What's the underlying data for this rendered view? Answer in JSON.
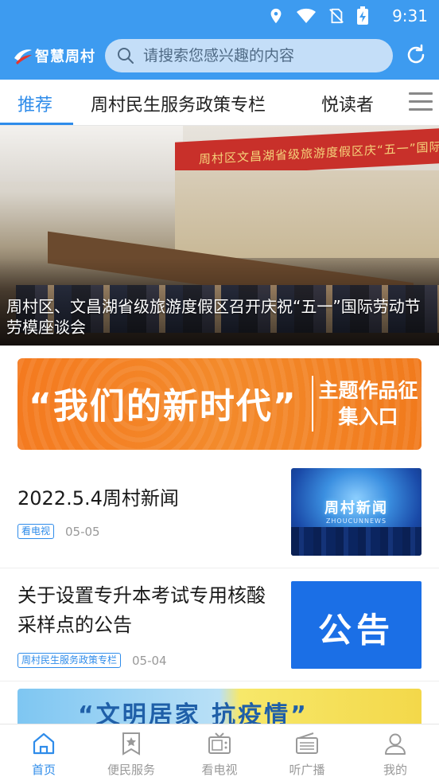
{
  "status_bar": {
    "time": "9:31",
    "icons": [
      "location-icon",
      "wifi-icon",
      "no-sim-icon",
      "battery-charging-icon"
    ]
  },
  "header": {
    "app_name": "智慧周村",
    "search_placeholder": "请搜索您感兴趣的内容",
    "refresh_icon": "refresh-icon",
    "brand_color": "#3d9bf0"
  },
  "tabs": {
    "items": [
      {
        "label": "推荐",
        "active": true
      },
      {
        "label": "周村民生服务政策专栏",
        "active": false
      },
      {
        "label": "悦读者",
        "active": false
      }
    ],
    "menu_icon": "menu-icon",
    "accent_color": "#2f8cea"
  },
  "hero": {
    "caption": "周村区、文昌湖省级旅游度假区召开庆祝“五一”国际劳动节劳模座谈会",
    "banner_text": "周村区文昌湖省级旅游度假区庆“五一”国际劳动节劳模座谈会"
  },
  "promo": {
    "main_text": "“我们的新时代”",
    "side_text": "主题作品征集入口",
    "color": "#f47a1f"
  },
  "news": [
    {
      "title": "2022.5.4周村新闻",
      "tag": "看电视",
      "date": "05-05",
      "thumb_title": "周村新闻",
      "thumb_subtitle": "ZHOUCUNNEWS"
    },
    {
      "title": "关于设置专升本考试专用核酸采样点的公告",
      "tag": "周村民生服务政策专栏",
      "date": "05-04",
      "thumb_title": "公告"
    }
  ],
  "banner2": {
    "text": "“文明居家 抗疫情”"
  },
  "bottom_nav": [
    {
      "label": "首页",
      "icon": "home-icon",
      "active": true
    },
    {
      "label": "便民服务",
      "icon": "bookmark-star-icon",
      "active": false
    },
    {
      "label": "看电视",
      "icon": "tv-icon",
      "active": false
    },
    {
      "label": "听广播",
      "icon": "radio-icon",
      "active": false
    },
    {
      "label": "我的",
      "icon": "user-icon",
      "active": false
    }
  ]
}
